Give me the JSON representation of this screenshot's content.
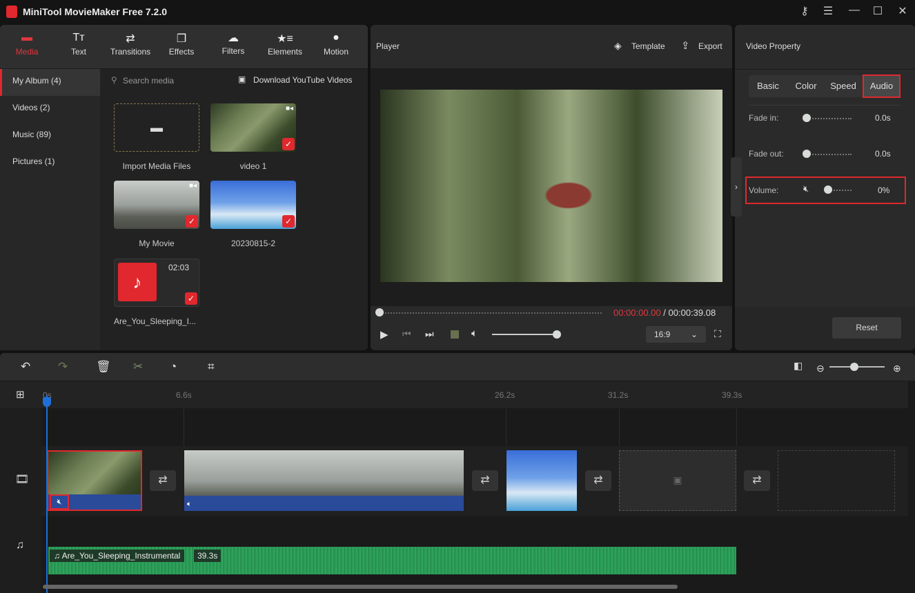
{
  "app": {
    "title": "MiniTool MovieMaker Free 7.2.0"
  },
  "window_icons": [
    "key-icon",
    "menu-icon",
    "minimize-icon",
    "maximize-icon",
    "close-icon"
  ],
  "toolbar": [
    {
      "label": "Media",
      "icon": "folder-icon",
      "active": true
    },
    {
      "label": "Text",
      "icon": "text-icon"
    },
    {
      "label": "Transitions",
      "icon": "transitions-icon"
    },
    {
      "label": "Effects",
      "icon": "effects-icon"
    },
    {
      "label": "Filters",
      "icon": "filters-icon"
    },
    {
      "label": "Elements",
      "icon": "elements-icon"
    },
    {
      "label": "Motion",
      "icon": "motion-icon"
    }
  ],
  "sidebar": [
    {
      "label": "My Album (4)",
      "active": true
    },
    {
      "label": "Videos (2)"
    },
    {
      "label": "Music (89)"
    },
    {
      "label": "Pictures (1)"
    }
  ],
  "media": {
    "search_placeholder": "Search media",
    "download_label": "Download YouTube Videos",
    "items": [
      {
        "label": "Import Media Files"
      },
      {
        "label": "video 1"
      },
      {
        "label": "My Movie"
      },
      {
        "label": "20230815-2"
      },
      {
        "label": "Are_You_Sleeping_I...",
        "duration": "02:03"
      }
    ]
  },
  "player": {
    "title": "Player",
    "template_label": "Template",
    "export_label": "Export",
    "current_time": "00:00:00.00",
    "separator": " / ",
    "total_time": "00:00:39.08",
    "aspect": "16:9",
    "progress": 0,
    "volume": 1.0
  },
  "property": {
    "title": "Video Property",
    "tabs": [
      "Basic",
      "Color",
      "Speed",
      "Audio"
    ],
    "active_tab": "Audio",
    "fade_in_label": "Fade in:",
    "fade_in_value": "0.0s",
    "fade_out_label": "Fade out:",
    "fade_out_value": "0.0s",
    "volume_label": "Volume:",
    "volume_value": "0%",
    "reset_label": "Reset"
  },
  "timeline": {
    "ruler": [
      "0s",
      "6.6s",
      "26.2s",
      "31.2s",
      "39.3s"
    ],
    "audio_clip": {
      "name": "Are_You_Sleeping_Instrumental",
      "duration": "39.3s"
    }
  },
  "colors": {
    "accent": "#e0282e",
    "playhead": "#1e6fd8",
    "audio": "#2a9d57"
  }
}
